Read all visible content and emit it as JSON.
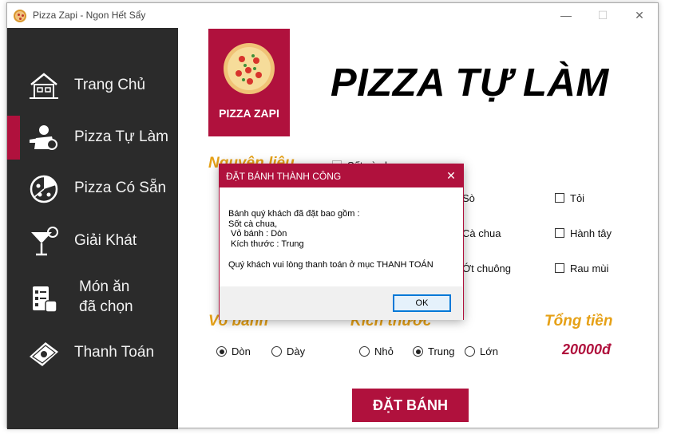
{
  "window": {
    "title": "Pizza Zapi - Ngon Hết Sẩy",
    "minimize": "—",
    "maximize": "☐",
    "close": "✕"
  },
  "sidebar": {
    "items": [
      {
        "label": "Trang Chủ",
        "icon": "house-icon",
        "active": false
      },
      {
        "label": "Pizza Tự Làm",
        "icon": "chef-icon",
        "active": true
      },
      {
        "label": "Pizza Có Sẵn",
        "icon": "pizza-icon",
        "active": false
      },
      {
        "label": "Giải Khát",
        "icon": "cocktail-icon",
        "active": false
      },
      {
        "label_line1": "Món ăn",
        "label_line2": "đã chọn",
        "icon": "menu-list-icon",
        "active": false
      },
      {
        "label": "Thanh Toán",
        "icon": "money-icon",
        "active": false
      }
    ]
  },
  "logo": {
    "text": "PIZZA ZAPI"
  },
  "heading": "PIZZA TỰ LÀM",
  "ingredients": {
    "title": "Nguyên liệu",
    "items": [
      {
        "label": "Sốt cà chua",
        "checked": false
      },
      {
        "label": "Sò",
        "checked": false
      },
      {
        "label": "Tỏi",
        "checked": false
      },
      {
        "label": "Cà chua",
        "checked": false
      },
      {
        "label": "Hành tây",
        "checked": false
      },
      {
        "label": "Ớt chuông",
        "checked": false
      },
      {
        "label": "Rau mùi",
        "checked": false
      }
    ]
  },
  "crust": {
    "title": "Vỏ bánh",
    "options": [
      {
        "label": "Dòn",
        "selected": true
      },
      {
        "label": "Dày",
        "selected": false
      }
    ]
  },
  "size": {
    "title": "Kích thước",
    "options": [
      {
        "label": "Nhỏ",
        "selected": false
      },
      {
        "label": "Trung",
        "selected": true
      },
      {
        "label": "Lớn",
        "selected": false
      }
    ]
  },
  "total": {
    "title": "Tổng tiền",
    "value": "20000đ"
  },
  "order_button": "ĐẶT BÁNH",
  "dialog": {
    "title": "ĐẶT BÁNH THÀNH CÔNG",
    "close": "✕",
    "line1": "Bánh quý khách đã đặt bao gồm :",
    "line2": "Sốt cà chua,",
    "line3": " Vỏ bánh : Dòn",
    "line4": " Kích thước : Trung",
    "message": "Quý khách vui lòng thanh toán ở mục THANH TOÁN",
    "ok": "OK"
  },
  "colors": {
    "accent": "#b0113d",
    "sidebar": "#2b2b2b",
    "section_title": "#e6a117"
  }
}
